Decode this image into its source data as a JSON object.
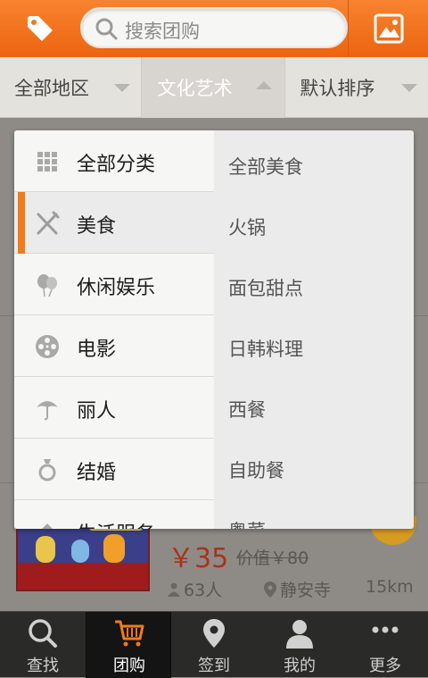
{
  "topbar": {
    "search_placeholder": "搜索团购"
  },
  "filters": [
    {
      "label": "全部地区",
      "arrow": "down"
    },
    {
      "label": "文化艺术",
      "arrow": "up"
    },
    {
      "label": "默认排序",
      "arrow": "down"
    }
  ],
  "dropdown": {
    "categories": [
      {
        "label": "全部分类",
        "icon": "grid-icon"
      },
      {
        "label": "美食",
        "icon": "fork-knife-icon",
        "active": true
      },
      {
        "label": "休闲娱乐",
        "icon": "balloon-icon"
      },
      {
        "label": "电影",
        "icon": "film-reel-icon"
      },
      {
        "label": "丽人",
        "icon": "umbrella-icon"
      },
      {
        "label": "结婚",
        "icon": "ring-icon"
      },
      {
        "label": "生活服务",
        "icon": "service-icon"
      }
    ],
    "subcategories": [
      "全部美食",
      "火锅",
      "面包甜点",
      "日韩料理",
      "西餐",
      "自助餐",
      "粤菜"
    ]
  },
  "deal": {
    "price": "￥35",
    "original_price": "价值￥80",
    "buyers": "63人",
    "location": "静安寺",
    "distance": "15km"
  },
  "bottom_nav": [
    {
      "label": "查找",
      "icon": "search-icon"
    },
    {
      "label": "团购",
      "icon": "cart-icon",
      "active": true
    },
    {
      "label": "签到",
      "icon": "location-pin-icon"
    },
    {
      "label": "我的",
      "icon": "user-icon"
    },
    {
      "label": "更多",
      "icon": "more-icon"
    }
  ],
  "colors": {
    "accent": "#f07a1c",
    "price": "#a8341a"
  }
}
